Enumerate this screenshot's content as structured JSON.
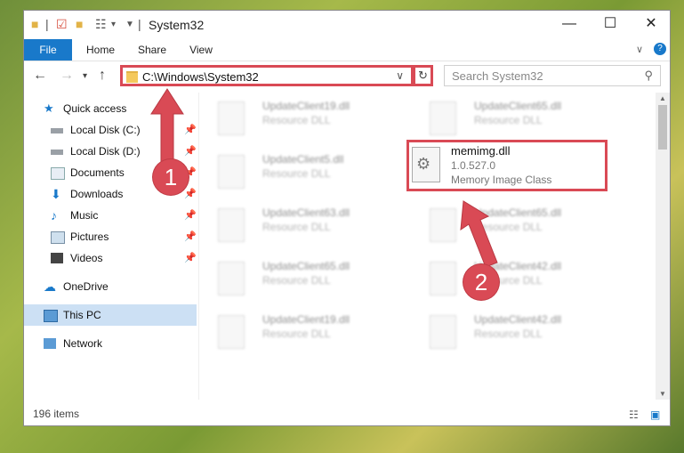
{
  "window": {
    "title": "System32"
  },
  "ribbon": {
    "tabs": [
      "File",
      "Home",
      "Share",
      "View"
    ]
  },
  "address": {
    "path": "C:\\Windows\\System32"
  },
  "search": {
    "placeholder": "Search System32"
  },
  "nav": {
    "items": [
      {
        "label": "Quick access"
      },
      {
        "label": "Local Disk (C:)"
      },
      {
        "label": "Local Disk (D:)"
      },
      {
        "label": "Documents"
      },
      {
        "label": "Downloads"
      },
      {
        "label": "Music"
      },
      {
        "label": "Pictures"
      },
      {
        "label": "Videos"
      },
      {
        "label": "OneDrive"
      },
      {
        "label": "This PC"
      },
      {
        "label": "Network"
      }
    ]
  },
  "files": {
    "left": [
      {
        "name": "UpdateClient19.dll",
        "type": "Resource DLL"
      },
      {
        "name": "UpdateClient5.dll",
        "type": "Resource DLL"
      },
      {
        "name": "UpdateClient63.dll",
        "type": "Resource DLL"
      },
      {
        "name": "UpdateClient65.dll",
        "type": "Resource DLL"
      },
      {
        "name": "UpdateClient19.dll",
        "type": "Resource DLL"
      }
    ],
    "right": [
      {
        "name": "UpdateClient65.dll",
        "type": "Resource DLL"
      },
      {
        "name": "UpdateClient65.dll",
        "type": "Resource DLL"
      },
      {
        "name": "UpdateClient42.dll",
        "type": "Resource DLL"
      },
      {
        "name": "UpdateClient42.dll",
        "type": "Resource DLL"
      }
    ]
  },
  "featured": {
    "name": "memimg.dll",
    "version": "1.0.527.0",
    "description": "Memory Image Class"
  },
  "status": {
    "item_count": "196 items"
  },
  "callouts": {
    "one": "1",
    "two": "2"
  },
  "colors": {
    "accent": "#1979ca",
    "callout": "#d94a55"
  }
}
